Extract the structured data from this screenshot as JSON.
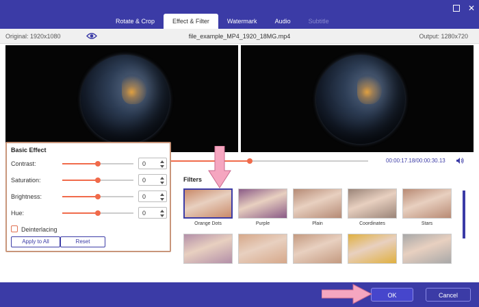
{
  "tabs": [
    {
      "label": "Rotate & Crop"
    },
    {
      "label": "Effect & Filter"
    },
    {
      "label": "Watermark"
    },
    {
      "label": "Audio"
    },
    {
      "label": "Subtitle"
    }
  ],
  "info": {
    "original": "Original: 1920x1080",
    "filename": "file_example_MP4_1920_18MG.mp4",
    "output": "Output: 1280x720"
  },
  "player": {
    "time": "00:00:17.18/00:00:30.13",
    "progress": 0.58
  },
  "basic_effect": {
    "title": "Basic Effect",
    "rows": [
      {
        "label": "Contrast:",
        "value": "0",
        "level": 0.5
      },
      {
        "label": "Saturation:",
        "value": "0",
        "level": 0.5
      },
      {
        "label": "Brightness:",
        "value": "0",
        "level": 0.5
      },
      {
        "label": "Hue:",
        "value": "0",
        "level": 0.5
      }
    ],
    "deinterlacing": "Deinterlacing",
    "apply_all": "Apply to All",
    "reset": "Reset"
  },
  "filters": {
    "title": "Filters",
    "items": [
      {
        "label": "Orange Dots",
        "color": "#c98a6a"
      },
      {
        "label": "Purple",
        "color": "#8a5a86"
      },
      {
        "label": "Plain",
        "color": "#b58a75"
      },
      {
        "label": "Coordinates",
        "color": "#9a8478"
      },
      {
        "label": "Stars",
        "color": "#b88a74"
      },
      {
        "label": "",
        "color": "#b38fa8"
      },
      {
        "label": "",
        "color": "#d6a88a"
      },
      {
        "label": "",
        "color": "#c49a80"
      },
      {
        "label": "",
        "color": "#e0b040"
      },
      {
        "label": "",
        "color": "#a8a8a8"
      }
    ]
  },
  "footer": {
    "ok": "OK",
    "cancel": "Cancel"
  },
  "colors": {
    "accent": "#3b3ba6",
    "slider": "#f06a4a",
    "highlight_border": "#c8957a",
    "arrow": "#f5a6c0"
  }
}
